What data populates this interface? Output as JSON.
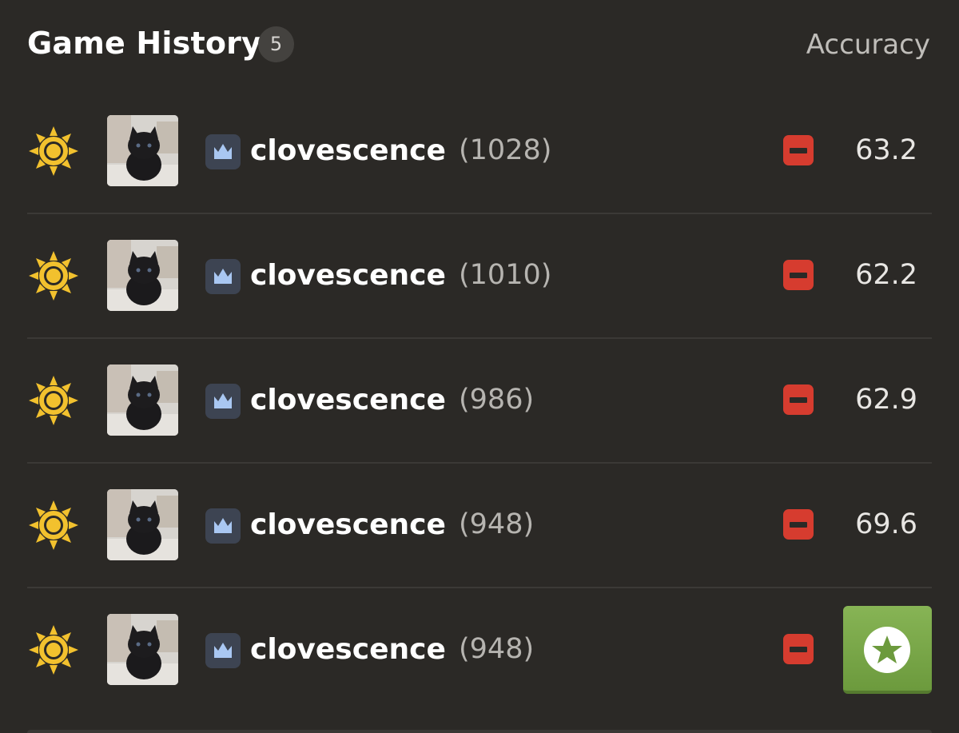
{
  "header": {
    "title": "Game History",
    "count": "5",
    "accuracy_label": "Accuracy"
  },
  "colors": {
    "background": "#2b2926",
    "sun": "#f2c12e",
    "loss": "#d63c2f",
    "review_green": "#7aab4a",
    "membership_badge": "#3d4452",
    "membership_crown": "#a9c7f2"
  },
  "rows": [
    {
      "time_control_icon": "sun-icon",
      "username": "clovescence",
      "rating": "(1028)",
      "result": "loss",
      "accuracy": "63.2"
    },
    {
      "time_control_icon": "sun-icon",
      "username": "clovescence",
      "rating": "(1010)",
      "result": "loss",
      "accuracy": "62.2"
    },
    {
      "time_control_icon": "sun-icon",
      "username": "clovescence",
      "rating": "(986)",
      "result": "loss",
      "accuracy": "62.9"
    },
    {
      "time_control_icon": "sun-icon",
      "username": "clovescence",
      "rating": "(948)",
      "result": "loss",
      "accuracy": "69.6"
    },
    {
      "time_control_icon": "sun-icon",
      "username": "clovescence",
      "rating": "(948)",
      "result": "loss",
      "accuracy": "",
      "action_icon": "star-icon"
    }
  ]
}
